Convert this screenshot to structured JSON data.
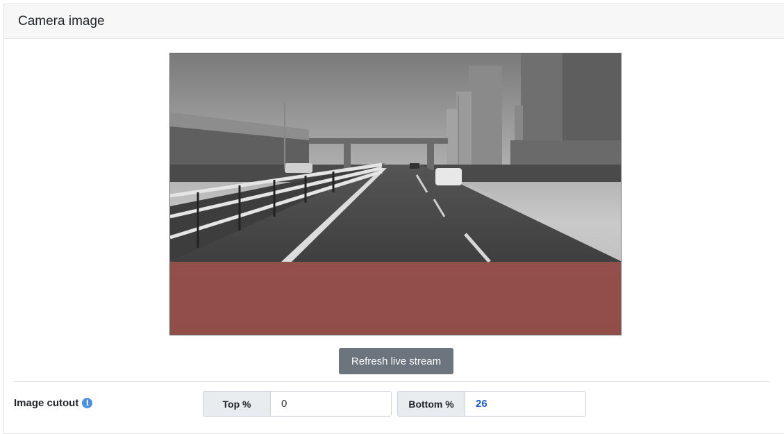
{
  "panel": {
    "title": "Camera image"
  },
  "camera": {
    "cutout_top_percent": 0,
    "cutout_bottom_percent": 26,
    "overlay_color": "#9c524c"
  },
  "actions": {
    "refresh_label": "Refresh live stream"
  },
  "cutout": {
    "label": "Image cutout",
    "info_icon": "info-icon",
    "top_label": "Top %",
    "top_value": "0",
    "bottom_label": "Bottom %",
    "bottom_value": "26"
  }
}
